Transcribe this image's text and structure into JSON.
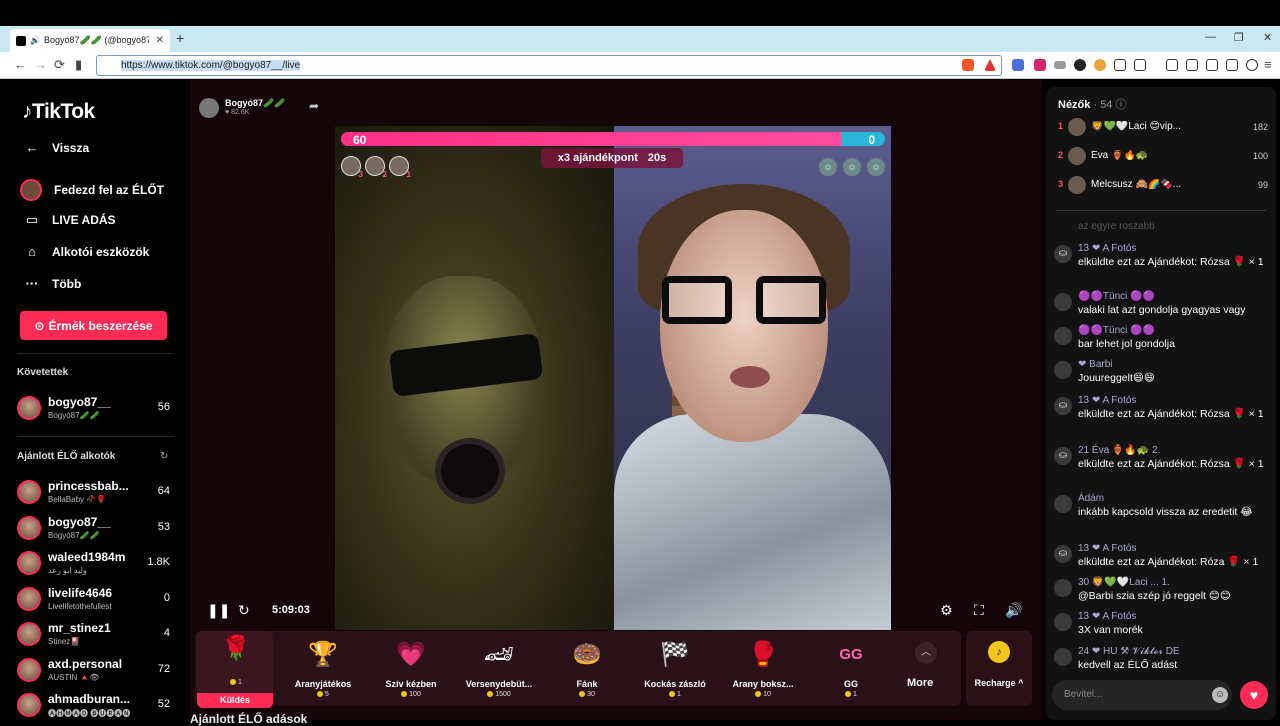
{
  "browser": {
    "tab_title": "Bogyó87🥒🥒 (@bogyo87__",
    "url": "https://www.tiktok.com/@bogyo87__/live",
    "new_tab": "+",
    "win_min": "—",
    "win_max": "❐",
    "win_close": "✕"
  },
  "sidebar": {
    "logo": "TikTok",
    "nav": [
      {
        "label": "Vissza",
        "icon": "back-arrow-icon"
      },
      {
        "label": "Fedezd fel az ÉLŐT",
        "icon": "explore-live-icon"
      },
      {
        "label": "LIVE ADÁS",
        "icon": "live-camera-icon"
      },
      {
        "label": "Alkotói eszközök",
        "icon": "creator-tools-icon"
      },
      {
        "label": "Több",
        "icon": "more-dots-icon"
      }
    ],
    "coins_button": "Érmék beszerzése",
    "following_title": "Követettek",
    "following": [
      {
        "name": "bogyo87__",
        "sub": "Bogyó87🥒🥒",
        "count": "56"
      }
    ],
    "recommended_title": "Ajánlott ÉLŐ alkotók",
    "recommended": [
      {
        "name": "princessbab...",
        "sub": "BellaBaby 🥀🌹",
        "count": "64"
      },
      {
        "name": "bogyo87__",
        "sub": "Bogyó87🥒🥒",
        "count": "53"
      },
      {
        "name": "waleed1984m",
        "sub": "وليد ابو رعد",
        "count": "1.8K"
      },
      {
        "name": "livelife4646",
        "sub": "Livelifetothefullest",
        "count": "0"
      },
      {
        "name": "mr_stinez1",
        "sub": "Stinez🎴",
        "count": "4"
      },
      {
        "name": "axd.personal",
        "sub": "AUSTIN 🔺👁",
        "count": "72"
      },
      {
        "name": "ahmadburan...",
        "sub": "🅐🅗🅜🅐🅓 🅑🅤🅡🅐🅝",
        "count": "52"
      }
    ]
  },
  "stream": {
    "host_name": "Bogyó87🥒🥒",
    "host_likes": "♥ 82.6K",
    "pk_left_score": "60",
    "pk_right_score": "0",
    "pk_left_share": 1.0,
    "bonus_label": "x3 ajándékpont",
    "bonus_timer": "20s",
    "ranks": [
      "3",
      "2",
      "1"
    ],
    "elapsed": "5:09:03"
  },
  "gifts": [
    {
      "name": "Küldés",
      "price": "1",
      "icon": "🌹",
      "selected": true
    },
    {
      "name": "Aranyjátékos",
      "price": "5",
      "icon": "🏆"
    },
    {
      "name": "Szív kézben",
      "price": "100",
      "icon": "💗"
    },
    {
      "name": "Versenydebüt...",
      "price": "1500",
      "icon": "🏎"
    },
    {
      "name": "Fánk",
      "price": "30",
      "icon": "🍩"
    },
    {
      "name": "Kockás zászló",
      "price": "1",
      "icon": "🏁"
    },
    {
      "name": "Arany boksz...",
      "price": "10",
      "icon": "🥊"
    },
    {
      "name": "GG",
      "price": "1",
      "icon": "GG"
    }
  ],
  "more_label": "More",
  "recharge_label": "Recharge ^",
  "section_below": "Ajánlott ÉLŐ adások",
  "chat": {
    "title": "Nézők",
    "viewer_count": "· 54",
    "top_viewers": [
      {
        "rank": "1",
        "name": "🦁💚🤍Laci 😊vip...",
        "score": "182"
      },
      {
        "rank": "2",
        "name": "Éva 🏺🔥🐢",
        "score": "100"
      },
      {
        "rank": "3",
        "name": "Melcsusz 🙈🌈🍫...",
        "score": "99"
      }
    ],
    "faded": "az egyre roszabb",
    "messages": [
      {
        "who": "13 ❤ A Fotós",
        "text": "elküldte ezt az Ajándékot: Rózsa 🌹 × 1"
      },
      {
        "who": "🟣🟣Tünci 🟣🟣",
        "text": "valaki lat azt gondolja gyagyas vagy"
      },
      {
        "who": "🟣🟣Tünci 🟣🟣",
        "text": "bar lehet jol gondolja"
      },
      {
        "who": "❤ Barbi",
        "text": "Jouureggelt😄😄"
      },
      {
        "who": "13 ❤ A Fotós",
        "text": "elküldte ezt az Ajándékot: Rózsa 🌹 × 1"
      },
      {
        "who": "21 Éva 🏺🔥🐢 2.",
        "text": "elküldte ezt az Ajándékot: Rózsa 🌹 × 1"
      },
      {
        "who": "Ádám",
        "text": "inkább kapcsold vissza az eredetit 😂"
      },
      {
        "who": "13 ❤ A Fotós",
        "text": "elküldte ezt az Ajándékot: Róza 🌹 × 1"
      },
      {
        "who": "30 🦁💚🤍Laci ... 1.",
        "text": "@Barbi szia szép jó reggelt 😊😊"
      },
      {
        "who": "13 ❤ A Fotós",
        "text": "3X van morék"
      },
      {
        "who": "24 ❤ HU ⚒ 𝓥𝓲𝓴𝓽𝓸𝓻 DE",
        "text": "kedvell az ÉLŐ adást"
      }
    ],
    "input_placeholder": "Bevitel..."
  }
}
